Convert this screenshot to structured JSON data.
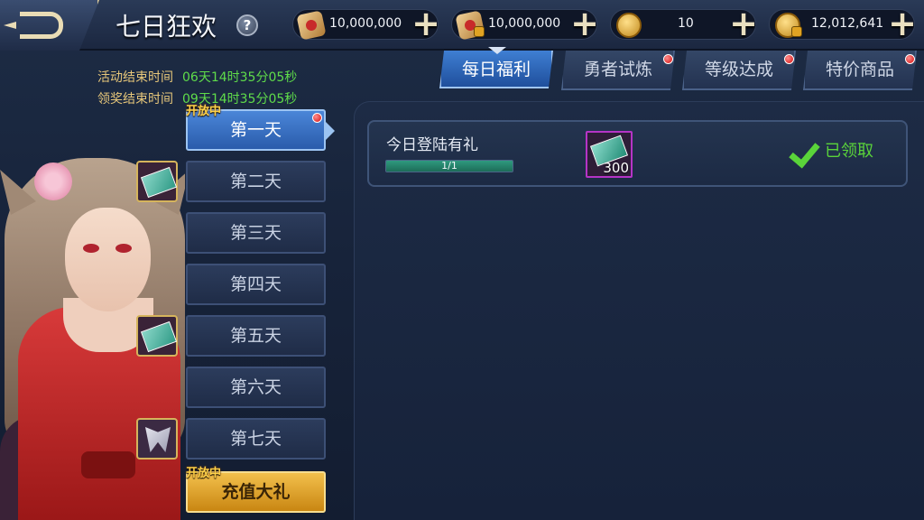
{
  "header": {
    "title": "七日狂欢",
    "help": "?"
  },
  "resources": [
    {
      "icon": "scroll-icon",
      "value": "10,000,000"
    },
    {
      "icon": "locked-scroll-icon",
      "value": "10,000,000"
    },
    {
      "icon": "gold-coin-icon",
      "value": "10"
    },
    {
      "icon": "locked-coin-icon",
      "value": "12,012,641"
    }
  ],
  "plus_symbol": "+",
  "timers": {
    "event_end_label": "活动结束时间",
    "event_end_value": "06天14时35分05秒",
    "claim_end_label": "领奖结束时间",
    "claim_end_value": "09天14时35分05秒"
  },
  "tabs": [
    {
      "label": "每日福利",
      "active": true,
      "badge": false
    },
    {
      "label": "勇者试炼",
      "active": false,
      "badge": true
    },
    {
      "label": "等级达成",
      "active": false,
      "badge": true
    },
    {
      "label": "特价商品",
      "active": false,
      "badge": true
    }
  ],
  "days": [
    {
      "label": "第一天",
      "state": "active",
      "tag": "开放中",
      "badge": true
    },
    {
      "label": "第二天",
      "state": "normal"
    },
    {
      "label": "第三天",
      "state": "normal"
    },
    {
      "label": "第四天",
      "state": "normal"
    },
    {
      "label": "第五天",
      "state": "normal"
    },
    {
      "label": "第六天",
      "state": "normal"
    },
    {
      "label": "第七天",
      "state": "normal"
    },
    {
      "label": "充值大礼",
      "state": "gold",
      "tag": "开放中"
    }
  ],
  "rewards": [
    {
      "title": "今日登陆有礼",
      "progress_text": "1/1",
      "progress_fraction": 1.0,
      "item_qty": "300",
      "status": "已领取"
    }
  ],
  "colors": {
    "accent_blue": "#3f7fd3",
    "timer_green": "#5fdc4a",
    "timer_label_gold": "#e7c77a",
    "claimed_green": "#5ad43a",
    "gold_button": "#f2c04c"
  }
}
